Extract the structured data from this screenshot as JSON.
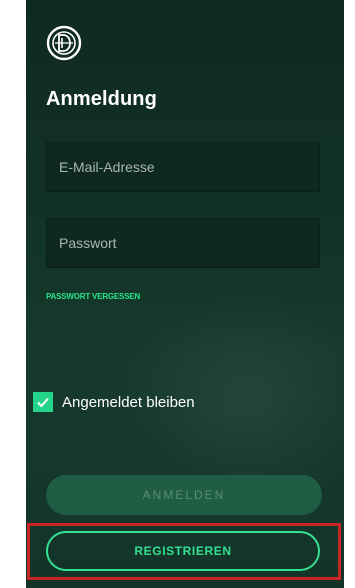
{
  "app": {
    "logo_icon": "dfb-logo-icon"
  },
  "login": {
    "title": "Anmeldung",
    "email": {
      "placeholder": "E-Mail-Adresse",
      "value": ""
    },
    "password": {
      "placeholder": "Passwort",
      "value": ""
    },
    "forgot_label": "PASSWORT VERGESSEN",
    "remember": {
      "label": "Angemeldet bleiben",
      "checked": true,
      "icon": "checkmark-icon"
    },
    "login_button_label": "ANMELDEN",
    "register_button_label": "REGISTRIEREN"
  },
  "colors": {
    "background": "#123226",
    "accent": "#29e38a",
    "login_button": "#1f5d45",
    "highlight_border": "#c8252b"
  }
}
